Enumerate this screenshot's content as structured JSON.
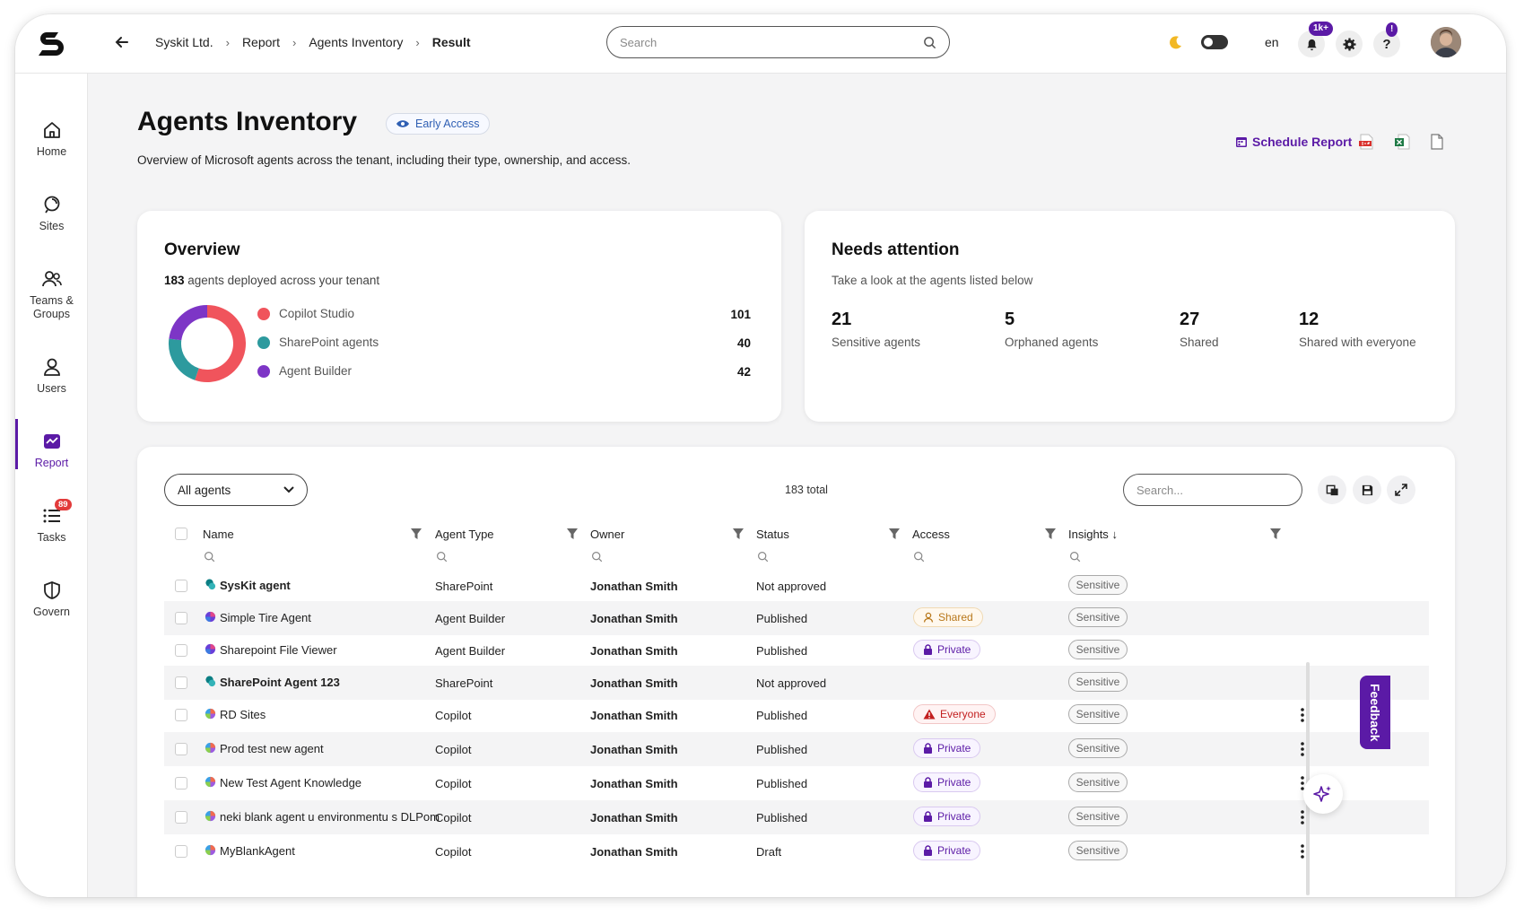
{
  "topbar": {
    "breadcrumbs": [
      "Syskit Ltd.",
      "Report",
      "Agents Inventory",
      "Result"
    ],
    "search_placeholder": "Search",
    "language": "en",
    "notifications_badge": "1k+",
    "help_badge": "!"
  },
  "sidebar": {
    "items": [
      {
        "label": "Home",
        "icon": "home-icon"
      },
      {
        "label": "Sites",
        "icon": "sites-icon"
      },
      {
        "label": "Teams & Groups",
        "icon": "teams-icon"
      },
      {
        "label": "Users",
        "icon": "user-icon"
      },
      {
        "label": "Report",
        "icon": "report-icon",
        "active": true
      },
      {
        "label": "Tasks",
        "icon": "tasks-icon",
        "badge": "89"
      },
      {
        "label": "Govern",
        "icon": "shield-icon"
      }
    ]
  },
  "header": {
    "title": "Agents Inventory",
    "early_access": "Early Access",
    "subtitle": "Overview of Microsoft agents across the tenant, including their type, ownership, and access.",
    "schedule_report": "Schedule Report"
  },
  "overview": {
    "title": "Overview",
    "count": "183",
    "subtitle_rest": " agents deployed across your tenant",
    "legend": [
      {
        "label": "Copilot Studio",
        "value": "101",
        "color": "#f0545c"
      },
      {
        "label": "SharePoint agents",
        "value": "40",
        "color": "#2d9a9e"
      },
      {
        "label": "Agent Builder",
        "value": "42",
        "color": "#7d35c6"
      }
    ]
  },
  "attention": {
    "title": "Needs attention",
    "subtitle": "Take a look at the agents listed below",
    "stats": [
      {
        "value": "21",
        "label": "Sensitive agents"
      },
      {
        "value": "5",
        "label": "Orphaned agents"
      },
      {
        "value": "27",
        "label": "Shared"
      },
      {
        "value": "12",
        "label": "Shared with everyone"
      }
    ]
  },
  "table": {
    "filter_select": "All agents",
    "total": "183 total",
    "search_placeholder": "Search...",
    "columns": {
      "name": "Name",
      "type": "Agent Type",
      "owner": "Owner",
      "status": "Status",
      "access": "Access",
      "insights": "Insights"
    },
    "rows": [
      {
        "name": "SysKit agent",
        "bold": true,
        "kind": "sharepoint",
        "type": "SharePoint",
        "owner": "Jonathan Smith",
        "status": "Not approved",
        "access": "",
        "insight": "Sensitive",
        "menu": false
      },
      {
        "name": "Simple Tire Agent",
        "bold": false,
        "kind": "builder",
        "type": "Agent Builder",
        "owner": "Jonathan Smith",
        "status": "Published",
        "access": "Shared",
        "insight": "Sensitive",
        "menu": false
      },
      {
        "name": "Sharepoint File Viewer",
        "bold": false,
        "kind": "builder",
        "type": "Agent Builder",
        "owner": "Jonathan Smith",
        "status": "Published",
        "access": "Private",
        "insight": "Sensitive",
        "menu": false
      },
      {
        "name": "SharePoint Agent 123",
        "bold": true,
        "kind": "sharepoint",
        "type": "SharePoint",
        "owner": "Jonathan Smith",
        "status": "Not approved",
        "access": "",
        "insight": "Sensitive",
        "menu": false
      },
      {
        "name": "RD Sites",
        "bold": false,
        "kind": "copilot",
        "type": "Copilot",
        "owner": "Jonathan Smith",
        "status": "Published",
        "access": "Everyone",
        "insight": "Sensitive",
        "menu": true
      },
      {
        "name": "Prod test new agent",
        "bold": false,
        "kind": "copilot",
        "type": "Copilot",
        "owner": "Jonathan Smith",
        "status": "Published",
        "access": "Private",
        "insight": "Sensitive",
        "menu": true
      },
      {
        "name": "New Test Agent Knowledge",
        "bold": false,
        "kind": "copilot",
        "type": "Copilot",
        "owner": "Jonathan Smith",
        "status": "Published",
        "access": "Private",
        "insight": "Sensitive",
        "menu": true
      },
      {
        "name": "neki blank agent u environmentu s DLPom",
        "bold": false,
        "kind": "copilot",
        "type": "Copilot",
        "owner": "Jonathan Smith",
        "status": "Published",
        "access": "Private",
        "insight": "Sensitive",
        "menu": true
      },
      {
        "name": "MyBlankAgent",
        "bold": false,
        "kind": "copilot",
        "type": "Copilot",
        "owner": "Jonathan Smith",
        "status": "Draft",
        "access": "Private",
        "insight": "Sensitive",
        "menu": true
      }
    ]
  },
  "feedback": "Feedback",
  "colors": {
    "accent": "#5b1aa6"
  }
}
